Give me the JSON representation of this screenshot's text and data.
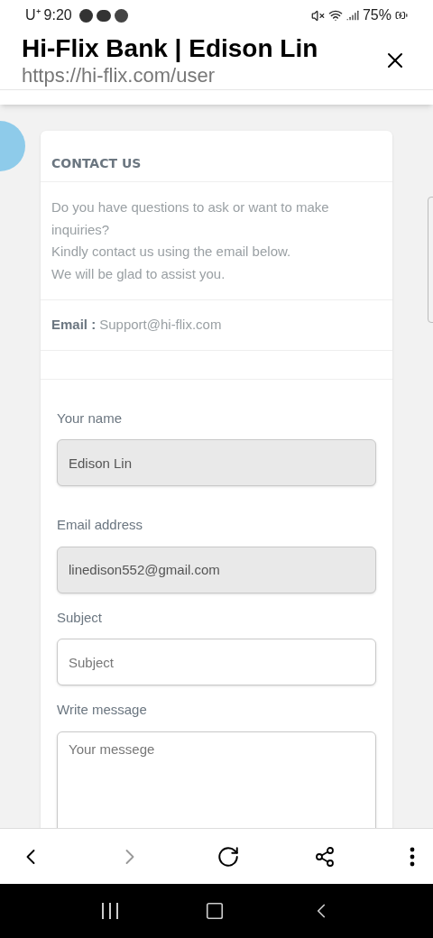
{
  "status_bar": {
    "carrier": "U⁺",
    "time": "9:20",
    "battery": "75%"
  },
  "header": {
    "title": "Hi-Flix Bank | Edison Lin",
    "url": "https://hi-flix.com/user"
  },
  "contact_card": {
    "title": "CONTACT US",
    "intro_lines": [
      "Do you have questions to ask or want to make inquiries?",
      "Kindly contact us using the email below.",
      "We will be glad to assist you."
    ],
    "email_label": "Email :",
    "email_value": "Support@hi-flix.com"
  },
  "form": {
    "fields": [
      {
        "kind": "input",
        "label": "Your name",
        "value": "Edison Lin",
        "disabled": true
      },
      {
        "kind": "input",
        "label": "Email address",
        "value": "linedison552@gmail.com",
        "disabled": true
      },
      {
        "kind": "input",
        "label": "Subject",
        "placeholder": "Subject",
        "disabled": false
      },
      {
        "kind": "textarea",
        "label": "Write message",
        "placeholder": "Your messege",
        "disabled": false
      }
    ]
  },
  "toolbar": {
    "forward_disabled": true
  }
}
